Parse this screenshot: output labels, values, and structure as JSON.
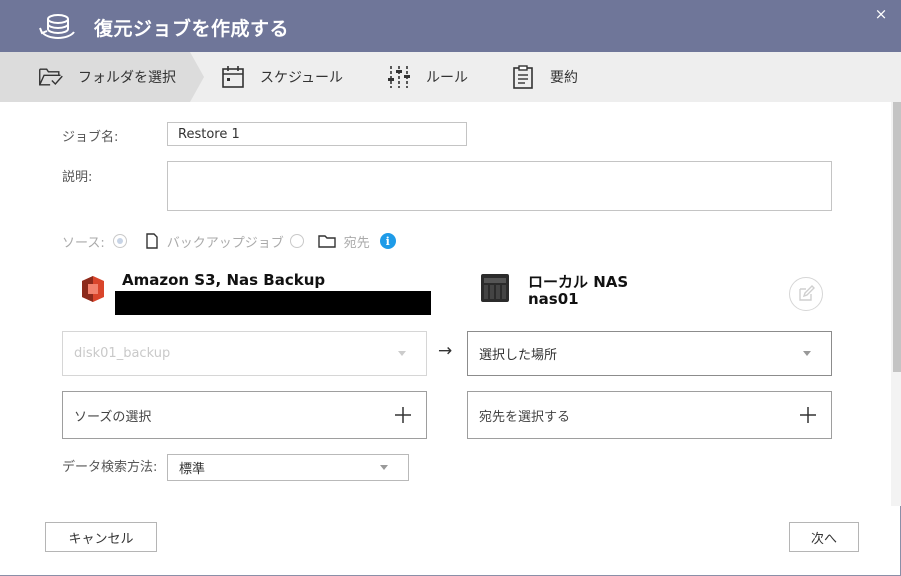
{
  "header": {
    "title": "復元ジョブを作成する",
    "close_label": "×",
    "logo_icon": "restore-cloud-icon",
    "bg_color": "#6f7699"
  },
  "steps": [
    {
      "label": "フォルダを選択",
      "icon": "folder-check-icon",
      "active": true
    },
    {
      "label": "スケジュール",
      "icon": "calendar-icon",
      "active": false
    },
    {
      "label": "ルール",
      "icon": "sliders-icon",
      "active": false
    },
    {
      "label": "要約",
      "icon": "clipboard-icon",
      "active": false
    }
  ],
  "form": {
    "job_name_label": "ジョブ名:",
    "job_name_value": "Restore 1",
    "description_label": "説明:",
    "description_value": "",
    "source_label": "ソース:",
    "source_option_backup_job": "バックアップジョブ",
    "source_option_destination": "宛先",
    "data_search_label": "データ検索方法:",
    "data_search_value": "標準"
  },
  "source": {
    "name": "Amazon S3, Nas Backup",
    "icon": "amazon-s3-icon",
    "folder_select_value": "disk01_backup",
    "picker_label": "ソーズの選択"
  },
  "destination": {
    "name": "ローカル NAS",
    "host": "nas01",
    "icon": "nas-device-icon",
    "location_select_value": "選択した場所",
    "picker_label": "宛先を選択する"
  },
  "arrow_symbol": "→",
  "footer": {
    "cancel_label": "キャンセル",
    "next_label": "次へ"
  },
  "colors": {
    "accent_info": "#1e9be8",
    "s3_brand": "#d9452b"
  }
}
